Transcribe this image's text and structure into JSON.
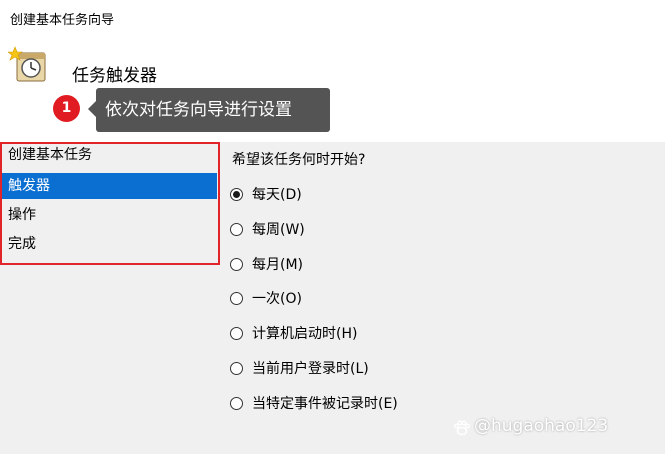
{
  "window": {
    "title": "创建基本任务向导"
  },
  "page": {
    "section_title": "任务触发器"
  },
  "annotation": {
    "step_number": "1",
    "callout_text": "依次对任务向导进行设置",
    "badge_color": "#e11b22",
    "callout_color": "#545454",
    "highlight_color": "#e0242a"
  },
  "nav": {
    "items": [
      {
        "label": "创建基本任务",
        "selected": false
      },
      {
        "label": "触发器",
        "selected": true
      },
      {
        "label": "操作",
        "selected": false
      },
      {
        "label": "完成",
        "selected": false
      }
    ],
    "selected_color": "#0a6fd1"
  },
  "trigger": {
    "question": "希望该任务何时开始?",
    "options": [
      {
        "label": "每天(D)",
        "checked": true
      },
      {
        "label": "每周(W)",
        "checked": false
      },
      {
        "label": "每月(M)",
        "checked": false
      },
      {
        "label": "一次(O)",
        "checked": false
      },
      {
        "label": "计算机启动时(H)",
        "checked": false
      },
      {
        "label": "当前用户登录时(L)",
        "checked": false
      },
      {
        "label": "当特定事件被记录时(E)",
        "checked": false
      }
    ]
  },
  "watermark": {
    "text": "@hugaohao123"
  },
  "icons": {
    "task_icon": "scheduled-task-clock-icon",
    "watermark_icon": "paw-icon"
  }
}
